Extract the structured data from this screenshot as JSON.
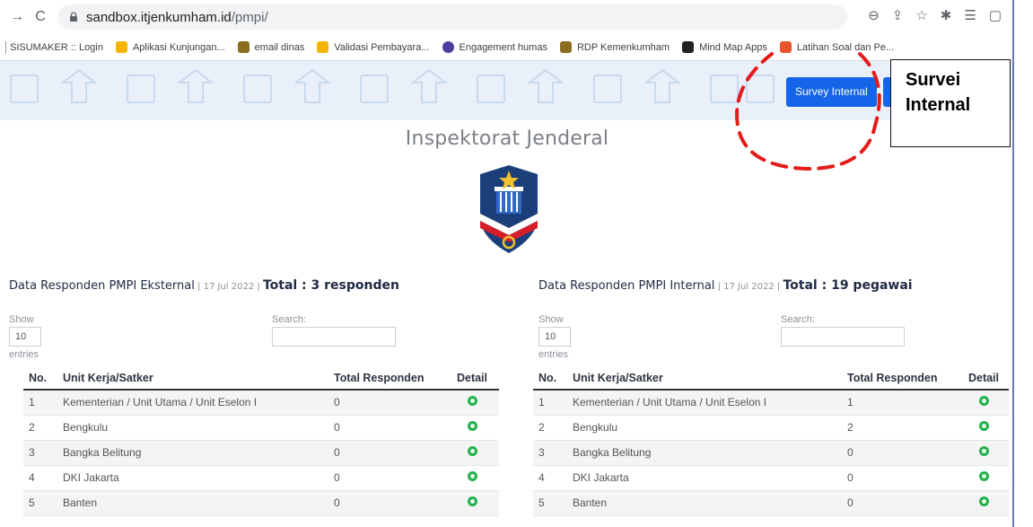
{
  "browser": {
    "url_host": "sandbox.itjenkumham.id",
    "url_path": "/pmpi/"
  },
  "bookmarks": [
    {
      "label": "SISUMAKER :: Login",
      "color": ""
    },
    {
      "label": "Aplikasi Kunjungan...",
      "color": "#f5b400"
    },
    {
      "label": "email dinas",
      "color": "#8a6d1e"
    },
    {
      "label": "Validasi Pembayara...",
      "color": "#f5b400"
    },
    {
      "label": "Engagement humas",
      "color": "#4b3c9e"
    },
    {
      "label": "RDP Kemenkumham",
      "color": "#8a6d1e"
    },
    {
      "label": "Mind Map Apps",
      "color": "#222222"
    },
    {
      "label": "Latihan Soal dan Pe...",
      "color": "#e8552d"
    }
  ],
  "header": {
    "survey_button": "Survey Internal"
  },
  "annotation": {
    "line1": "Survei",
    "line2": "Internal"
  },
  "page": {
    "title": "Inspektorat Jenderal"
  },
  "external": {
    "title": "Data Responden PMPI Eksternal",
    "date": " | 17 Jul 2022 | ",
    "total": "Total : 3 responden",
    "show_label": "Show",
    "entries_value": "10",
    "entries_label": "entries",
    "search_label": "Search:",
    "headers": [
      "No.",
      "Unit Kerja/Satker",
      "Total Responden",
      "Detail"
    ],
    "rows": [
      {
        "no": "1",
        "unit": "Kementerian / Unit Utama / Unit Eselon I",
        "total": "0"
      },
      {
        "no": "2",
        "unit": "Bengkulu",
        "total": "0"
      },
      {
        "no": "3",
        "unit": "Bangka Belitung",
        "total": "0"
      },
      {
        "no": "4",
        "unit": "DKI Jakarta",
        "total": "0"
      },
      {
        "no": "5",
        "unit": "Banten",
        "total": "0"
      }
    ]
  },
  "internal": {
    "title": "Data Responden PMPI Internal",
    "date": " | 17 Jul 2022 | ",
    "total": "Total : 19 pegawai",
    "show_label": "Show",
    "entries_value": "10",
    "entries_label": "entries",
    "search_label": "Search:",
    "headers": [
      "No.",
      "Unit Kerja/Satker",
      "Total Responden",
      "Detail"
    ],
    "rows": [
      {
        "no": "1",
        "unit": "Kementerian / Unit Utama / Unit Eselon I",
        "total": "1"
      },
      {
        "no": "2",
        "unit": "Bengkulu",
        "total": "2"
      },
      {
        "no": "3",
        "unit": "Bangka Belitung",
        "total": "0"
      },
      {
        "no": "4",
        "unit": "DKI Jakarta",
        "total": "0"
      },
      {
        "no": "5",
        "unit": "Banten",
        "total": "0"
      }
    ]
  },
  "colors": {
    "accent_blue": "#1565e8",
    "hero_bg": "#e9f0fa",
    "detail_green": "#22b14c",
    "annotation_red": "#e41b1b"
  }
}
